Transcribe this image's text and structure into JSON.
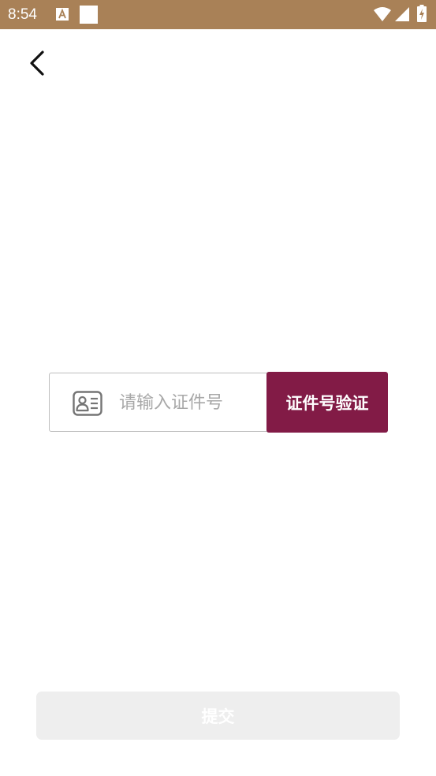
{
  "status_bar": {
    "time": "8:54",
    "background": "#a98157",
    "icons": [
      "text-a-icon",
      "white-square-icon",
      "wifi-icon",
      "cell-signal-icon",
      "battery-charging-icon"
    ]
  },
  "nav": {
    "back_icon": "chevron-left-icon"
  },
  "id_form": {
    "icon": "id-card-icon",
    "input_value": "",
    "input_placeholder": "请输入证件号",
    "verify_label": "证件号验证",
    "verify_color": "#821b46"
  },
  "footer": {
    "submit_label": "提交",
    "submit_color": "#eeeeee"
  }
}
